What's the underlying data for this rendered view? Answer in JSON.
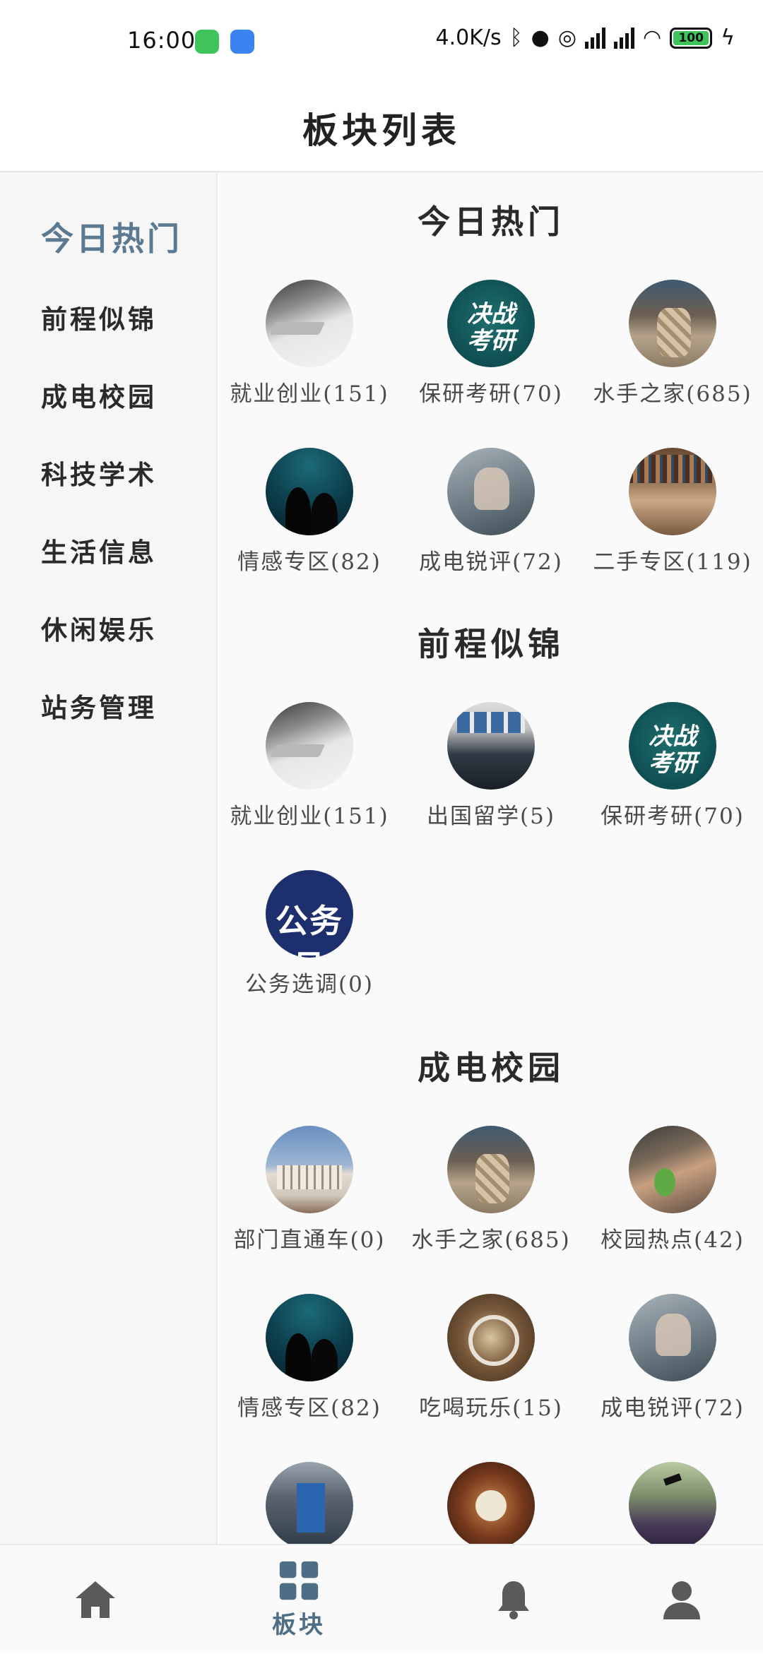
{
  "status_bar": {
    "time": "16:00",
    "net_speed": "4.0K/s",
    "battery": "100",
    "icons": [
      "wechat-icon",
      "android-icon",
      "bluetooth-icon",
      "qq-icon",
      "alarm-icon",
      "signal-icon",
      "signal-icon",
      "wifi-icon",
      "battery-icon",
      "charging-icon"
    ]
  },
  "header": {
    "title": "板块列表"
  },
  "sidebar": {
    "items": [
      {
        "label": "今日热门",
        "active": true
      },
      {
        "label": "前程似锦"
      },
      {
        "label": "成电校园"
      },
      {
        "label": "科技学术"
      },
      {
        "label": "生活信息"
      },
      {
        "label": "休闲娱乐"
      },
      {
        "label": "站务管理"
      }
    ]
  },
  "sections": [
    {
      "title": "今日热门",
      "boards": [
        {
          "label": "就业创业(151)",
          "thumb": "laptop-photo"
        },
        {
          "label": "保研考研(70)",
          "thumb": "kaoyan-poster"
        },
        {
          "label": "水手之家(685)",
          "thumb": "rope-photo"
        },
        {
          "label": "情感专区(82)",
          "thumb": "couple-silhouette"
        },
        {
          "label": "成电锐评(72)",
          "thumb": "newspaper-photo"
        },
        {
          "label": "二手专区(119)",
          "thumb": "bookshelf-photo"
        }
      ]
    },
    {
      "title": "前程似锦",
      "boards": [
        {
          "label": "就业创业(151)",
          "thumb": "laptop-photo"
        },
        {
          "label": "出国留学(5)",
          "thumb": "study-abroad-photo"
        },
        {
          "label": "保研考研(70)",
          "thumb": "kaoyan-poster"
        },
        {
          "label": "公务选调(0)",
          "thumb": "gongwuyuan-poster"
        }
      ]
    },
    {
      "title": "成电校园",
      "boards": [
        {
          "label": "部门直通车(0)",
          "thumb": "building-photo"
        },
        {
          "label": "水手之家(685)",
          "thumb": "rope-photo"
        },
        {
          "label": "校园热点(42)",
          "thumb": "campus-photo"
        },
        {
          "label": "情感专区(82)",
          "thumb": "couple-silhouette"
        },
        {
          "label": "吃喝玩乐(15)",
          "thumb": "food-photo"
        },
        {
          "label": "成电锐评(72)",
          "thumb": "newspaper-photo"
        },
        {
          "label": "",
          "thumb": "traffic-photo"
        },
        {
          "label": "",
          "thumb": "dinner-photo"
        },
        {
          "label": "",
          "thumb": "graduation-photo"
        }
      ]
    }
  ],
  "thumb_text": {
    "kaoyan": "决战\n考研",
    "gongwu": "公务员"
  },
  "bottom_nav": {
    "items": [
      {
        "icon": "home-icon",
        "label": ""
      },
      {
        "icon": "grid-icon",
        "label": "板块",
        "active": true
      },
      {
        "icon": "bell-icon",
        "label": ""
      },
      {
        "icon": "user-icon",
        "label": ""
      }
    ]
  },
  "colors": {
    "accent": "#5b7a92",
    "nav_inactive": "#5a5a5a"
  }
}
